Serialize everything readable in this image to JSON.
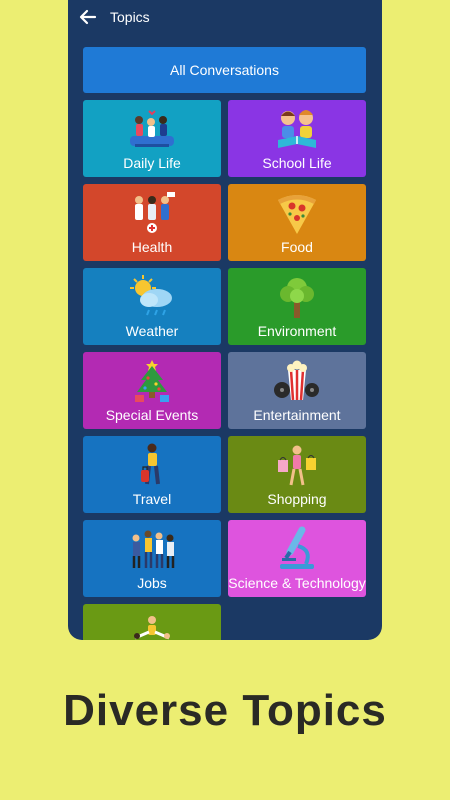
{
  "header": {
    "title": "Topics",
    "back_icon": "arrow-left-icon"
  },
  "all_button": {
    "label": "All Conversations",
    "color": "#1f7ad6"
  },
  "topics": [
    {
      "label": "Daily Life",
      "color": "#12a1c3",
      "icon": "people-icon"
    },
    {
      "label": "School Life",
      "color": "#8a35e4",
      "icon": "kids-reading-icon"
    },
    {
      "label": "Health",
      "color": "#d3472b",
      "icon": "doctors-icon"
    },
    {
      "label": "Food",
      "color": "#d98712",
      "icon": "pizza-icon"
    },
    {
      "label": "Weather",
      "color": "#1580bf",
      "icon": "sun-cloud-icon"
    },
    {
      "label": "Environment",
      "color": "#2a9b2a",
      "icon": "tree-icon"
    },
    {
      "label": "Special Events",
      "color": "#b32ab3",
      "icon": "christmas-tree-icon"
    },
    {
      "label": "Entertainment",
      "color": "#5e739b",
      "icon": "popcorn-film-icon"
    },
    {
      "label": "Travel",
      "color": "#1673c1",
      "icon": "traveler-icon"
    },
    {
      "label": "Shopping",
      "color": "#6a8a14",
      "icon": "shopping-bags-icon"
    },
    {
      "label": "Jobs",
      "color": "#1673c1",
      "icon": "workers-icon"
    },
    {
      "label": "Science & Technology",
      "color": "#de54de",
      "icon": "microscope-icon"
    },
    {
      "label": "",
      "color": "#6a9a14",
      "icon": "sports-icon"
    }
  ],
  "caption": "Diverse Topics",
  "page_background": "#ecee72",
  "phone_background": "#1b3964"
}
